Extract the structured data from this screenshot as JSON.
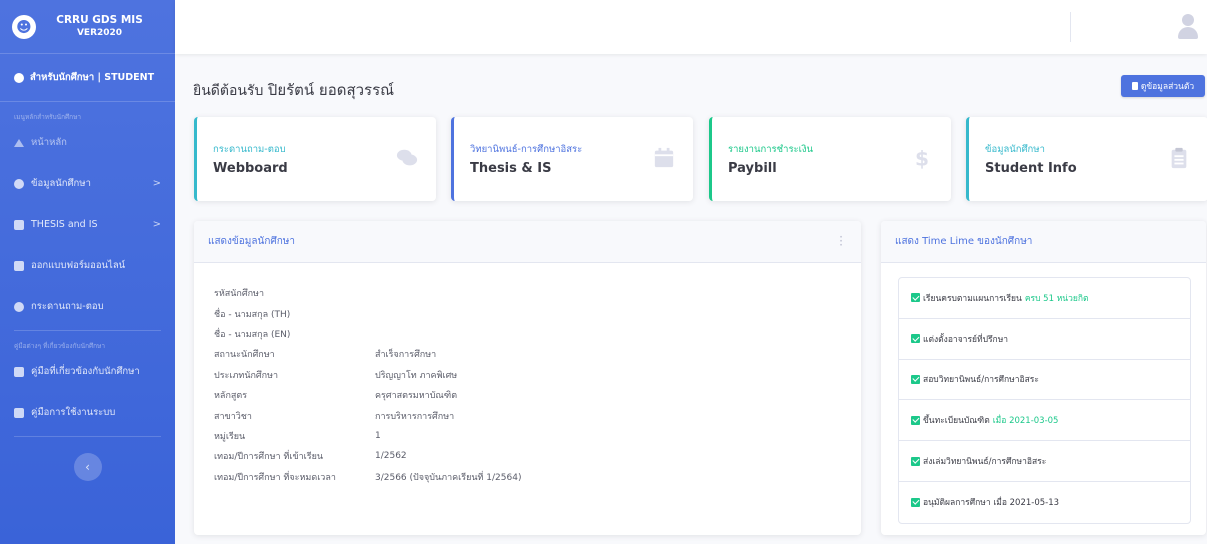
{
  "app": {
    "title": "CRRU GDS MIS",
    "version": "VER2020",
    "logo_icon": "smiley-face-icon"
  },
  "sidebar": {
    "top_item": {
      "label": "สำหรับนักศึกษา | STUDENT",
      "icon": "tachometer-icon"
    },
    "heading_main": "เมนูหลักสำหรับนักศึกษา",
    "items": [
      {
        "label": "หน้าหลัก",
        "icon": "home-icon",
        "faded": true
      },
      {
        "label": "ข้อมูลนักศึกษา",
        "icon": "user-icon",
        "chevron": ">"
      },
      {
        "label": "THESIS and IS",
        "icon": "table-icon",
        "chevron": ">"
      },
      {
        "label": "ออกแบบฟอร์มออนไลน์",
        "icon": "file-icon"
      },
      {
        "label": "กระดานถาม-ตอบ",
        "icon": "comment-icon"
      }
    ],
    "heading_docs": "คู่มือต่างๆ ที่เกี่ยวข้องกับนักศึกษา",
    "doc_items": [
      {
        "label": "คู่มือที่เกี่ยวข้องกับนักศึกษา",
        "icon": "folder-icon"
      },
      {
        "label": "คู่มือการใช้งานระบบ",
        "icon": "folder-icon"
      }
    ],
    "toggle_glyph": "‹"
  },
  "header": {
    "welcome": "ยินดีต้อนรับ",
    "user_name": "ปิยรัตน์ ยอดสุวรรณ์",
    "profile_button": "ดูข้อมูลส่วนตัว"
  },
  "cards": [
    {
      "caption": "กระดานถาม-ตอบ",
      "value": "Webboard",
      "icon": "comments-icon",
      "color": "#36b9cc"
    },
    {
      "caption": "วิทยานิพนธ์-การศึกษาอิสระ",
      "value": "Thesis & IS",
      "icon": "calendar-icon",
      "color": "#4e73df"
    },
    {
      "caption": "รายงานการชำระเงิน",
      "value": "Paybill",
      "icon": "dollar-icon",
      "color": "#1cc88a"
    },
    {
      "caption": "ข้อมูลนักศึกษา",
      "value": "Student Info",
      "icon": "clipboard-icon",
      "color": "#36b9cc"
    }
  ],
  "student_panel": {
    "title": "แสดงข้อมูลนักศึกษา",
    "rows": [
      {
        "label": "รหัสนักศึกษา",
        "value": ""
      },
      {
        "label": "ชื่อ - นามสกุล (TH)",
        "value": ""
      },
      {
        "label": "ชื่อ - นามสกุล (EN)",
        "value": ""
      },
      {
        "label": "สถานะนักศึกษา",
        "value": "สำเร็จการศึกษา"
      },
      {
        "label": "ประเภทนักศึกษา",
        "value": "ปริญญาโท ภาคพิเศษ"
      },
      {
        "label": "หลักสูตร",
        "value": "ครุศาสตรมหาบัณฑิต"
      },
      {
        "label": "สาขาวิชา",
        "value": "การบริหารการศึกษา"
      },
      {
        "label": "หมู่เรียน",
        "value": "1"
      },
      {
        "label": "เทอม/ปีการศึกษา ที่เข้าเรียน",
        "value": "1/2562"
      },
      {
        "label": "เทอม/ปีการศึกษา ที่จะหมดเวลา",
        "value": "3/2566 (ปัจจุบันภาคเรียนที่ 1/2564)"
      }
    ]
  },
  "timeline_panel": {
    "title": "แสดง Time Lime ของนักศึกษา",
    "items": [
      {
        "text": "เรียนครบตามแผนการเรียน",
        "highlight": "ครบ 51 หน่วยกิต"
      },
      {
        "text": "แต่งตั้งอาจารย์ที่ปรึกษา",
        "highlight": ""
      },
      {
        "text": "สอบวิทยานิพนธ์/การศึกษาอิสระ",
        "highlight": ""
      },
      {
        "text": "ขึ้นทะเบียนบัณฑิต",
        "highlight": "เมื่อ 2021-03-05"
      },
      {
        "text": "ส่งเล่มวิทยานิพนธ์/การศึกษาอิสระ",
        "highlight": ""
      },
      {
        "text": "อนุมัติผลการศึกษา เมื่อ 2021-05-13",
        "highlight": ""
      }
    ]
  }
}
